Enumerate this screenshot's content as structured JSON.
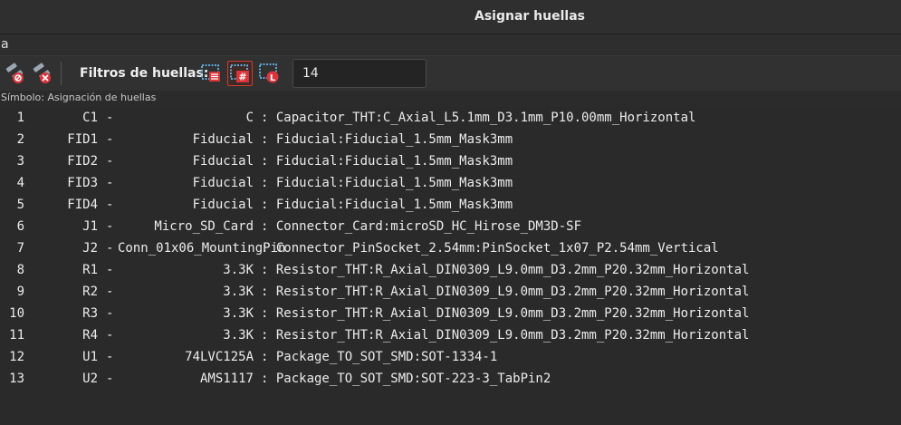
{
  "window": {
    "title": "Asignar huellas"
  },
  "menubar": {
    "items": [
      "a"
    ]
  },
  "toolbar": {
    "left_buttons": [
      {
        "icon": "associate-footprint-icon"
      },
      {
        "icon": "delete-association-icon"
      }
    ],
    "filters_label": "Filtros de huellas:",
    "filter_buttons": [
      {
        "icon": "filter-keywords-icon",
        "active": false
      },
      {
        "icon": "filter-pin-count-icon",
        "active": true
      },
      {
        "icon": "filter-library-icon",
        "active": false
      }
    ],
    "search_value": "14"
  },
  "panel": {
    "label": "Símbolo: Asignación de huellas"
  },
  "rows": [
    {
      "num": "1",
      "ref": "C1",
      "dash": "-",
      "value": "C",
      "footprint": ": Capacitor_THT:C_Axial_L5.1mm_D3.1mm_P10.00mm_Horizontal"
    },
    {
      "num": "2",
      "ref": "FID1",
      "dash": "-",
      "value": "Fiducial",
      "footprint": ": Fiducial:Fiducial_1.5mm_Mask3mm"
    },
    {
      "num": "3",
      "ref": "FID2",
      "dash": "-",
      "value": "Fiducial",
      "footprint": ": Fiducial:Fiducial_1.5mm_Mask3mm"
    },
    {
      "num": "4",
      "ref": "FID3",
      "dash": "-",
      "value": "Fiducial",
      "footprint": ": Fiducial:Fiducial_1.5mm_Mask3mm"
    },
    {
      "num": "5",
      "ref": "FID4",
      "dash": "-",
      "value": "Fiducial",
      "footprint": ": Fiducial:Fiducial_1.5mm_Mask3mm"
    },
    {
      "num": "6",
      "ref": "J1",
      "dash": "-",
      "value": "Micro_SD_Card",
      "footprint": ": Connector_Card:microSD_HC_Hirose_DM3D-SF"
    },
    {
      "num": "7",
      "ref": "J2",
      "dash": "-",
      "value": "Conn_01x06_MountingPin",
      "footprint": ": Connector_PinSocket_2.54mm:PinSocket_1x07_P2.54mm_Vertical"
    },
    {
      "num": "8",
      "ref": "R1",
      "dash": "-",
      "value": "3.3K",
      "footprint": ": Resistor_THT:R_Axial_DIN0309_L9.0mm_D3.2mm_P20.32mm_Horizontal"
    },
    {
      "num": "9",
      "ref": "R2",
      "dash": "-",
      "value": "3.3K",
      "footprint": ": Resistor_THT:R_Axial_DIN0309_L9.0mm_D3.2mm_P20.32mm_Horizontal"
    },
    {
      "num": "10",
      "ref": "R3",
      "dash": "-",
      "value": "3.3K",
      "footprint": ": Resistor_THT:R_Axial_DIN0309_L9.0mm_D3.2mm_P20.32mm_Horizontal"
    },
    {
      "num": "11",
      "ref": "R4",
      "dash": "-",
      "value": "3.3K",
      "footprint": ": Resistor_THT:R_Axial_DIN0309_L9.0mm_D3.2mm_P20.32mm_Horizontal"
    },
    {
      "num": "12",
      "ref": "U1",
      "dash": "-",
      "value": "74LVC125A",
      "footprint": ": Package_TO_SOT_SMD:SOT-1334-1"
    },
    {
      "num": "13",
      "ref": "U2",
      "dash": "-",
      "value": "AMS1117",
      "footprint": ": Package_TO_SOT_SMD:SOT-223-3_TabPin2"
    }
  ]
}
